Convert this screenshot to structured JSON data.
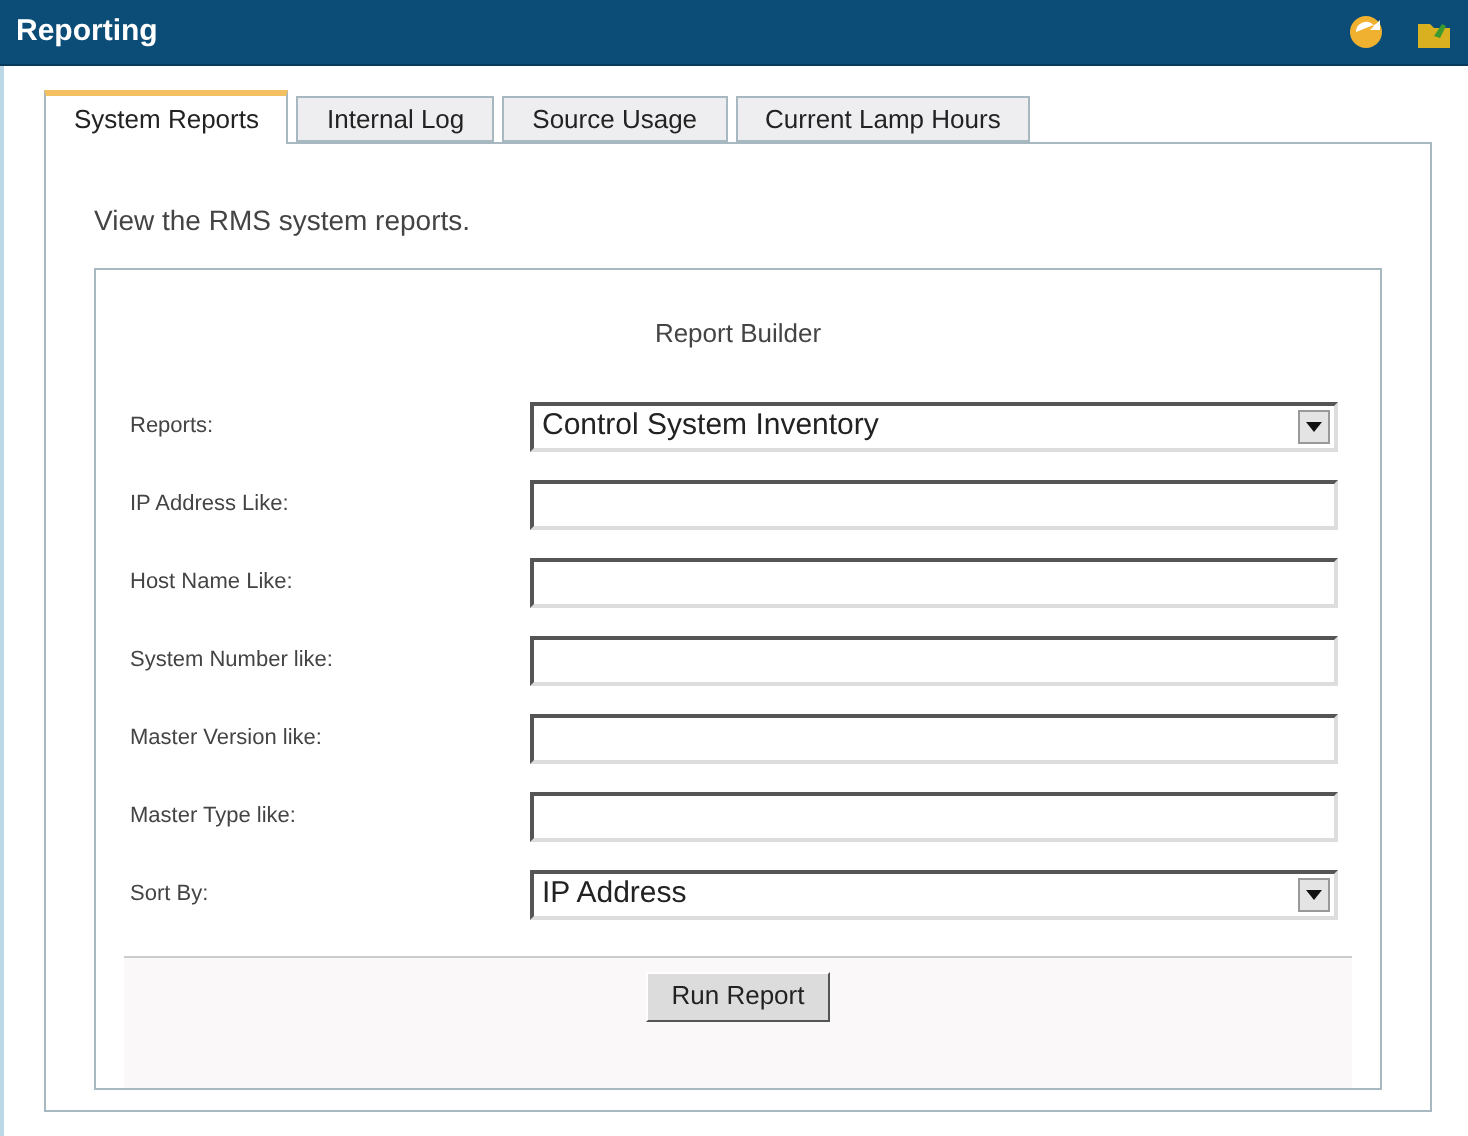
{
  "window": {
    "title": "Reporting"
  },
  "tabs": [
    {
      "label": "System Reports",
      "selected": true
    },
    {
      "label": "Internal Log",
      "selected": false
    },
    {
      "label": "Source Usage",
      "selected": false
    },
    {
      "label": "Current Lamp Hours",
      "selected": false
    }
  ],
  "description": "View the RMS system reports.",
  "report_builder": {
    "title": "Report Builder",
    "fields": [
      {
        "label": "Reports:",
        "kind": "select",
        "value": "Control System Inventory"
      },
      {
        "label": "IP Address Like:",
        "kind": "text"
      },
      {
        "label": "Host Name Like:",
        "kind": "text"
      },
      {
        "label": "System Number like:",
        "kind": "text"
      },
      {
        "label": "Master Version like:",
        "kind": "text"
      },
      {
        "label": "Master Type like:",
        "kind": "text"
      },
      {
        "label": "Sort By:",
        "kind": "select",
        "value": "IP Address"
      }
    ],
    "button": "Run Report"
  }
}
